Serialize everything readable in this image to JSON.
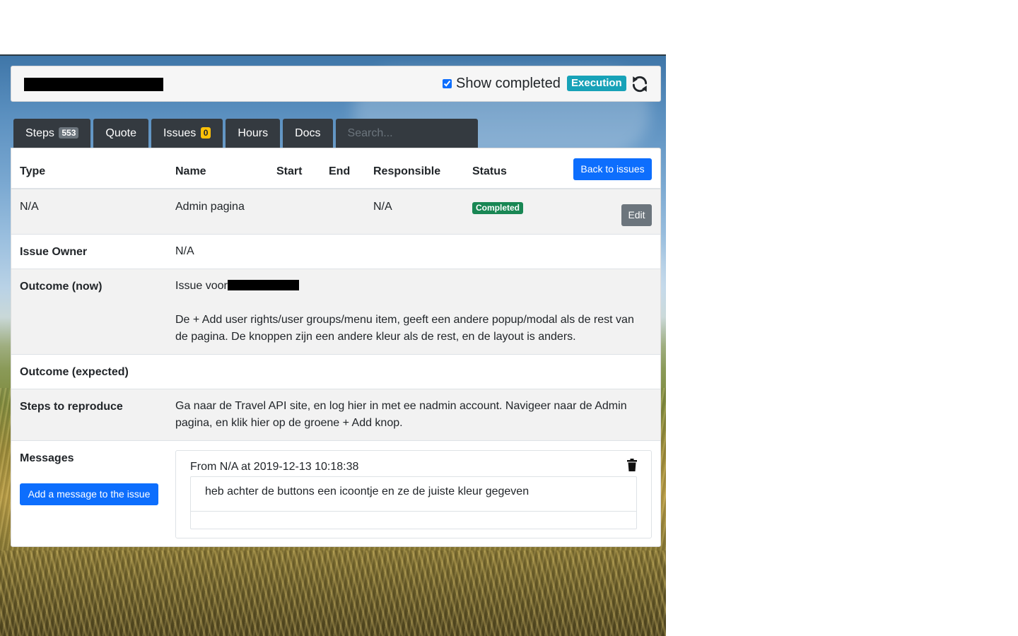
{
  "header": {
    "show_completed_label": "Show completed",
    "show_completed_checked": true,
    "phase_badge": "Execution"
  },
  "tabs": [
    {
      "label": "Steps",
      "badge": "553"
    },
    {
      "label": "Quote"
    },
    {
      "label": "Issues",
      "badge": "0"
    },
    {
      "label": "Hours"
    },
    {
      "label": "Docs"
    }
  ],
  "search": {
    "placeholder": "Search..."
  },
  "table": {
    "headers": [
      "Type",
      "Name",
      "Start",
      "End",
      "Responsible",
      "Status"
    ],
    "back_button": "Back to issues",
    "row": {
      "type": "N/A",
      "name": "Admin pagina",
      "start": "",
      "end": "",
      "responsible": "N/A",
      "status": "Completed",
      "edit_button": "Edit"
    }
  },
  "details": {
    "issue_owner_label": "Issue Owner",
    "issue_owner_value": "N/A",
    "outcome_now_label": "Outcome (now)",
    "outcome_now_prefix": "Issue voor",
    "outcome_now_text": "De + Add user rights/user groups/menu item, geeft een andere popup/modal als de rest van de pagina. De knoppen zijn een andere kleur als de rest, en de layout is anders.",
    "outcome_expected_label": "Outcome (expected)",
    "outcome_expected_value": "",
    "steps_label": "Steps to reproduce",
    "steps_text": "Ga naar de Travel API site, en log hier in met ee nadmin account. Navigeer naar de Admin pagina, en klik hier op de groene + Add knop.",
    "messages_label": "Messages",
    "add_message_button": "Add a message to the issue"
  },
  "messages": [
    {
      "header": "From N/A at 2019-12-13 10:18:38",
      "body": "heb achter de buttons een icoontje en ze de juiste kleur gegeven"
    }
  ],
  "colors": {
    "tab_bg": "#343a40",
    "primary": "#0d6efd",
    "secondary": "#6c757d",
    "success": "#198754",
    "info": "#17a2b8",
    "warning": "#ffc107"
  },
  "icons": [
    "refresh-icon",
    "trash-icon"
  ]
}
